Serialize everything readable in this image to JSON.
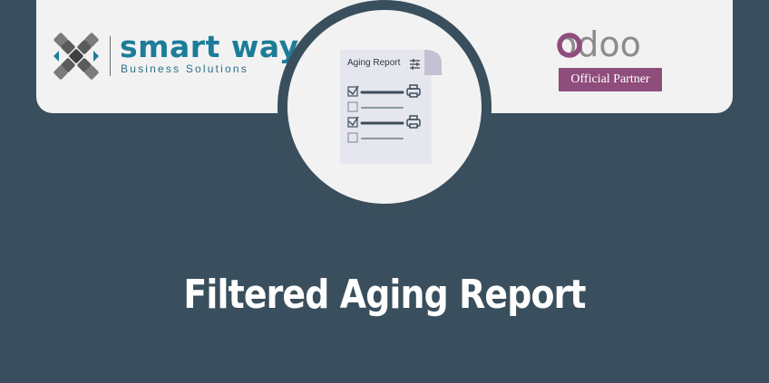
{
  "brand": {
    "company_name": "smart way",
    "company_tagline": "Business Solutions",
    "partner_wordmark": "odoo",
    "partner_badge": "Official Partner"
  },
  "illustration": {
    "doc_title": "Aging Report",
    "rows": [
      {
        "checked": true,
        "has_printer": true
      },
      {
        "checked": false,
        "has_printer": false
      },
      {
        "checked": true,
        "has_printer": true
      },
      {
        "checked": false,
        "has_printer": false
      }
    ],
    "icons": [
      "filter-sliders-icon",
      "checkbox-icon",
      "printer-icon"
    ]
  },
  "headline": "Filtered Aging Report",
  "colors": {
    "background": "#3a4f5d",
    "card": "#f2f2f3",
    "smartway_teal": "#1d7c97",
    "odoo_purple": "#8f4d7c",
    "odoo_grey": "#8c8c8c",
    "doc_paper": "#e6e6ef",
    "doc_fold": "#c3c0d1"
  }
}
